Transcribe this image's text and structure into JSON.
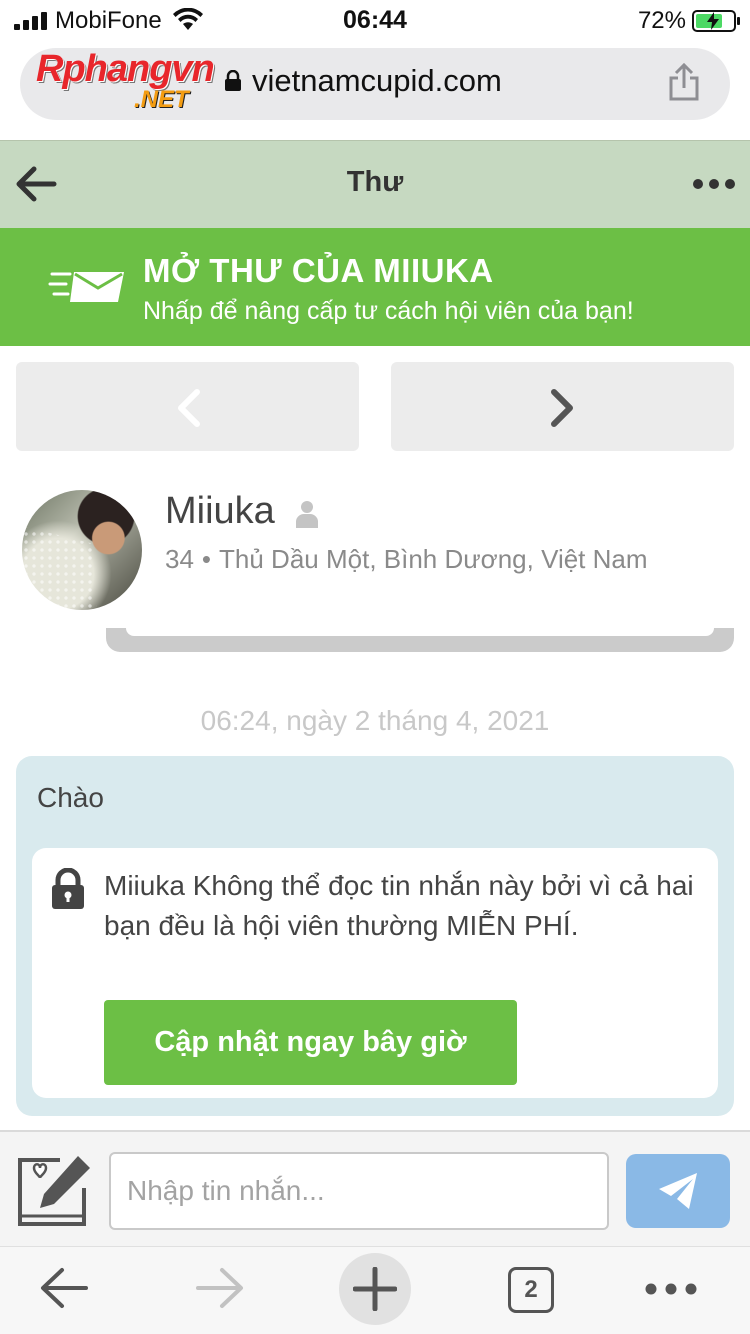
{
  "status_bar": {
    "carrier": "MobiFone",
    "time": "06:44",
    "battery_percent": "72%",
    "battery_level": 0.72
  },
  "browser": {
    "brand_main": "Rphangvn",
    "brand_sub": ".NET",
    "domain": "vietnamcupid.com",
    "open_tabs": "2"
  },
  "header": {
    "title": "Thư"
  },
  "banner": {
    "title": "MỞ THƯ CỦA MIIUKA",
    "subtitle": "Nhấp để nâng cấp tư cách hội viên của bạn!"
  },
  "profile": {
    "name": "Miiuka",
    "age": "34",
    "separator": "•",
    "location": "Thủ Dầu Một, Bình Dương, Việt Nam"
  },
  "message": {
    "timestamp": "06:24, ngày 2 tháng 4, 2021",
    "greeting": "Chào",
    "locked_notice": "Miiuka Không thể đọc tin nhắn này bởi vì cả hai bạn đều là hội viên thường MIỄN PHÍ.",
    "upgrade_label": "Cập nhật ngay bây giờ"
  },
  "compose": {
    "placeholder": "Nhập tin nhắn..."
  },
  "colors": {
    "accent_green": "#6cbf45",
    "header_bg": "#c6d9c1",
    "bubble_bg": "#d9eaee",
    "send_blue": "#8ab9e6"
  }
}
